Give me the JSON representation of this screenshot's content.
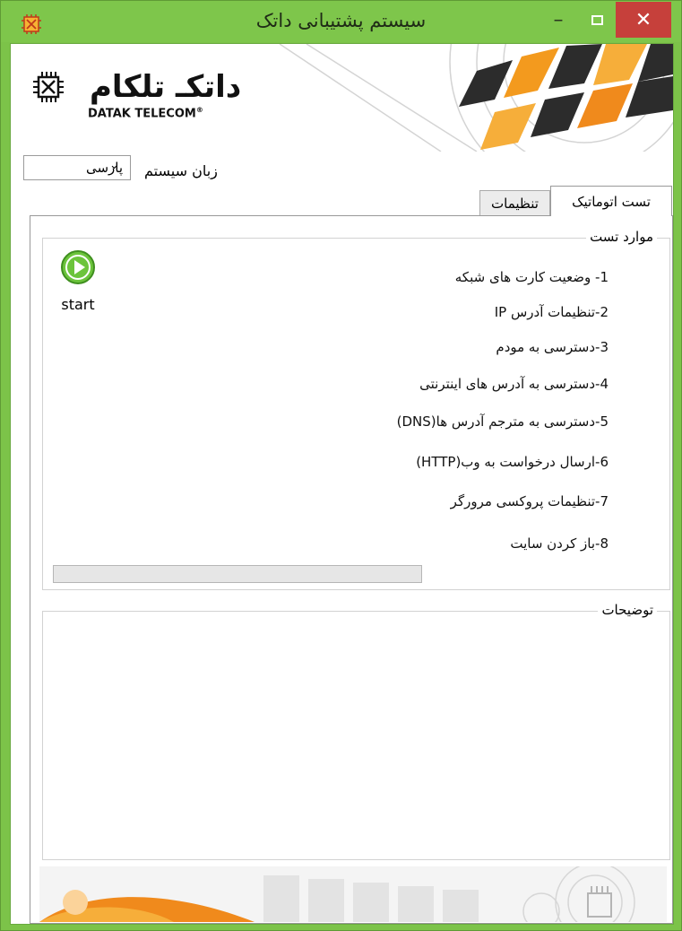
{
  "window": {
    "title": "سیستم پشتیبانی داتک",
    "controls": {
      "minimize": "–",
      "close": "✕"
    }
  },
  "banner": {
    "logo_fa": "داتکـ تلکام",
    "logo_en": "DATAK TELECOM",
    "logo_mark": "®"
  },
  "language": {
    "label": "زبان سیستم",
    "selected": "پارسی"
  },
  "tabs": [
    {
      "label": "تست اتوماتیک",
      "active": true
    },
    {
      "label": "تنظیمات",
      "active": false
    }
  ],
  "tests_group": {
    "title": "موارد تست",
    "start_label": "start",
    "items": [
      "1- وضعیت کارت های شبکه",
      "2-تنظیمات آدرس IP",
      "3-دسترسی به مودم",
      "4-دسترسی به آدرس های اینترنتی",
      "5-دسترسی به مترجم آدرس ها(DNS)",
      "6-ارسال درخواست به وب(HTTP)",
      "7-تنظیمات پروکسی مرورگر",
      "8-باز کردن سایت"
    ],
    "progress": 0
  },
  "description_group": {
    "title": "توضیحات"
  },
  "colors": {
    "frame": "#7cc349",
    "close": "#c6403b",
    "accent_orange": "#f08a1c",
    "start_green": "#6cc43c"
  }
}
